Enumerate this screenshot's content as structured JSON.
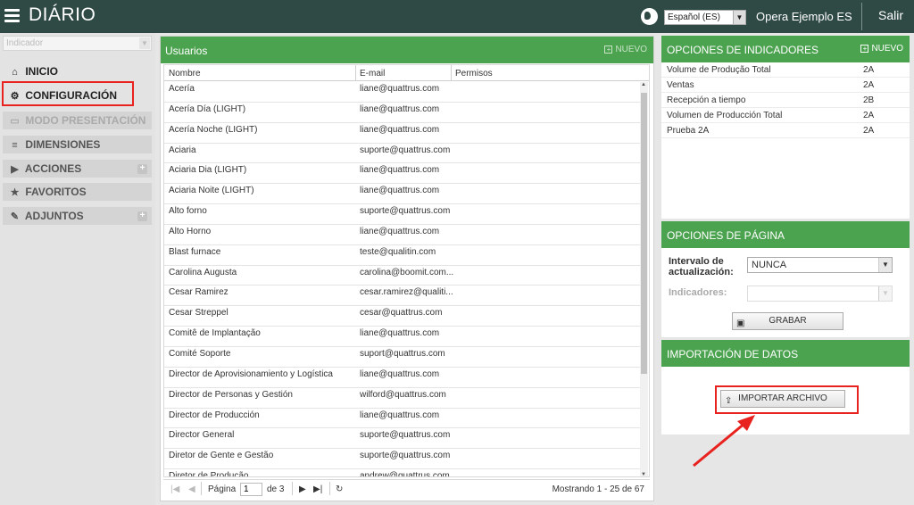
{
  "header": {
    "title": "DIÁRIO",
    "language": "Español (ES)",
    "operation": "Opera Ejemplo ES",
    "logout": "Salir"
  },
  "sidebar": {
    "indicator_placeholder": "Indicador",
    "items": [
      {
        "label": "INICIO",
        "icon": "home-icon"
      },
      {
        "label": "CONFIGURACIÓN",
        "icon": "gear-icon"
      },
      {
        "label": "MODO PRESENTACIÓN",
        "icon": "monitor-icon"
      },
      {
        "label": "DIMENSIONES",
        "icon": "database-icon"
      },
      {
        "label": "ACCIONES",
        "icon": "play-icon"
      },
      {
        "label": "FAVORITOS",
        "icon": "star-icon"
      },
      {
        "label": "ADJUNTOS",
        "icon": "paperclip-icon"
      }
    ]
  },
  "users_panel": {
    "title": "Usuarios",
    "new_label": "NUEVO",
    "columns": [
      "Nombre",
      "E-mail",
      "Permisos"
    ],
    "rows": [
      [
        "Acería",
        "liane@quattrus.com"
      ],
      [
        "Acería Día (LIGHT)",
        "liane@quattrus.com"
      ],
      [
        "Acería Noche (LIGHT)",
        "liane@quattrus.com"
      ],
      [
        "Aciaria",
        "suporte@quattrus.com"
      ],
      [
        "Aciaria Dia (LIGHT)",
        "liane@quattrus.com"
      ],
      [
        "Aciaria Noite (LIGHT)",
        "liane@quattrus.com"
      ],
      [
        "Alto forno",
        "suporte@quattrus.com"
      ],
      [
        "Alto Horno",
        "liane@quattrus.com"
      ],
      [
        "Blast furnace",
        "teste@qualitin.com"
      ],
      [
        "Carolina Augusta",
        "carolina@boomit.com..."
      ],
      [
        "Cesar Ramirez",
        "cesar.ramirez@qualiti..."
      ],
      [
        "Cesar Streppel",
        "cesar@quattrus.com"
      ],
      [
        "Comitê de Implantação",
        "liane@quattrus.com"
      ],
      [
        "Comité Soporte",
        "suport@quattrus.com"
      ],
      [
        "Director de Aprovisionamiento y Logística",
        "liane@quattrus.com"
      ],
      [
        "Director de Personas y Gestión",
        "wilford@quattrus.com"
      ],
      [
        "Director de Producción",
        "liane@quattrus.com"
      ],
      [
        "Director General",
        "suporte@quattrus.com"
      ],
      [
        "Diretor de Gente e Gestão",
        "suporte@quattrus.com"
      ],
      [
        "Diretor de Produção",
        "andrew@quattrus.com"
      ]
    ],
    "pager": {
      "page_label": "Página",
      "page_value": "1",
      "of_label": "de 3",
      "showing": "Mostrando 1 - 25 de 67"
    }
  },
  "indicators_panel": {
    "title": "OPCIONES DE INDICADORES",
    "new_label": "NUEVO",
    "rows": [
      [
        "Volume de Produção Total",
        "2A"
      ],
      [
        "Ventas",
        "2A"
      ],
      [
        "Recepción a tiempo",
        "2B"
      ],
      [
        "Volumen de Producción Total",
        "2A"
      ],
      [
        "Prueba 2A",
        "2A"
      ]
    ]
  },
  "page_options": {
    "title": "OPCIONES DE PÁGINA",
    "interval_label_1": "Intervalo de",
    "interval_label_2": "actualización:",
    "interval_value": "NUNCA",
    "indicators_label": "Indicadores:",
    "save_label": "GRABAR"
  },
  "import_panel": {
    "title": "IMPORTACIÓN DE DATOS",
    "button_label": "IMPORTAR ARCHIVO"
  },
  "colors": {
    "header_bg": "#2f4a45",
    "panel_green": "#4ba24f",
    "highlight_red": "#e8221e"
  }
}
